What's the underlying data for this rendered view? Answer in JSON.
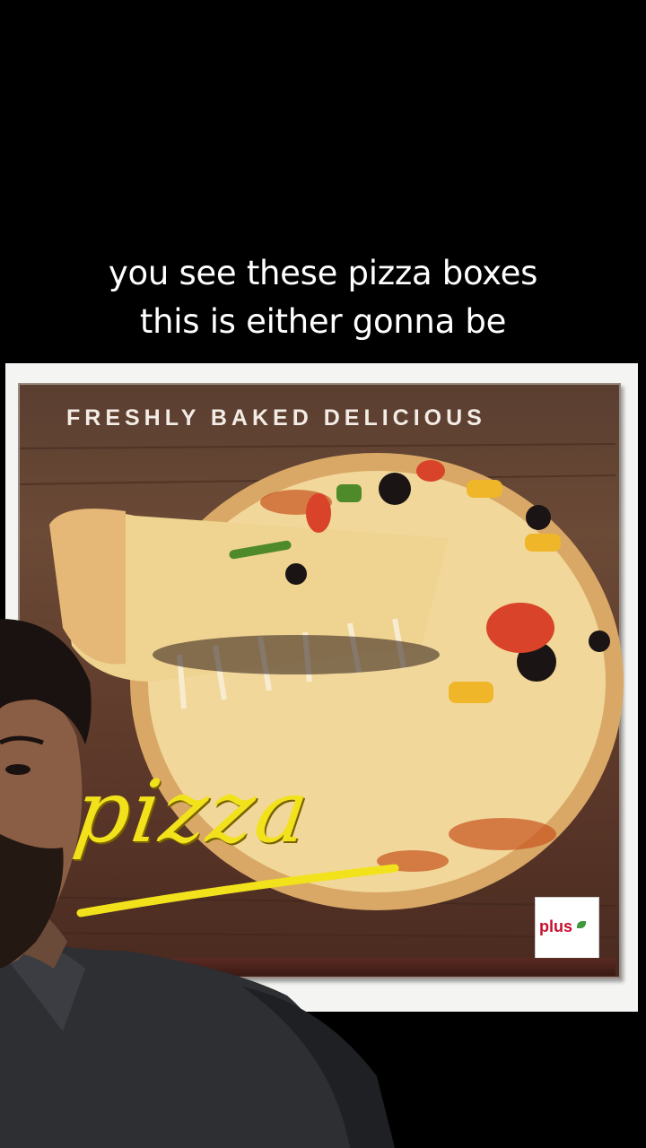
{
  "caption": {
    "line1": "you see these pizza boxes",
    "line2": "this is either gonna be"
  },
  "pizza_box": {
    "tagline": "FRESHLY BAKED DELICIOUS",
    "wordmark": "pizza",
    "logo_text": "plus"
  },
  "colors": {
    "background": "#000000",
    "caption_text": "#ffffff",
    "box_brown": "#5e3a2b",
    "wordmark_yellow": "#f2e21c",
    "logo_red": "#c8102e"
  }
}
